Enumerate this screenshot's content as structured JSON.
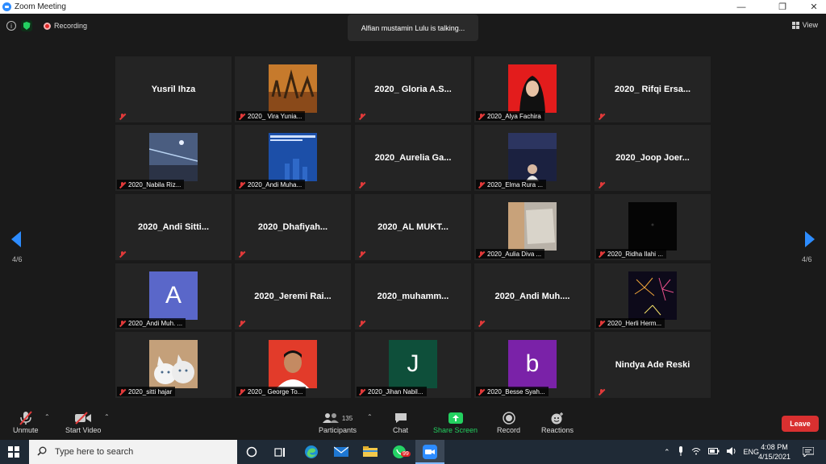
{
  "window": {
    "title": "Zoom Meeting",
    "minimize": "—",
    "restore": "❐",
    "close": "✕"
  },
  "topbar": {
    "recording_label": "Recording",
    "talking_text": "Alfian mustamin Lulu is talking...",
    "view_label": "View",
    "info_glyph": "i"
  },
  "navigation": {
    "page_left": "4/6",
    "page_right": "4/6"
  },
  "tiles": [
    {
      "center": "Yusril Ihza",
      "label": ""
    },
    {
      "center": "",
      "label": "2020_ Vira Yunia...",
      "video": "sunset-trees"
    },
    {
      "center": "2020_ Gloria A.S...",
      "label": ""
    },
    {
      "center": "",
      "label": "2020_Alya Fachira",
      "video": "hijab-red"
    },
    {
      "center": "2020_ Rifqi Ersa...",
      "label": ""
    },
    {
      "center": "",
      "label": "2020_Nabila Riz...",
      "video": "anime-night"
    },
    {
      "center": "",
      "label": "2020_Andi Muha...",
      "video": "blue-slide"
    },
    {
      "center": "2020_Aurelia Ga...",
      "label": ""
    },
    {
      "center": "",
      "label": "2020_Elma Rura ...",
      "video": "dark-room"
    },
    {
      "center": "2020_Joop Joer...",
      "label": ""
    },
    {
      "center": "2020_Andi Sitti...",
      "label": ""
    },
    {
      "center": "2020_Dhafiyah...",
      "label": ""
    },
    {
      "center": "2020_AL MUKT...",
      "label": ""
    },
    {
      "center": "",
      "label": "2020_Aulia Diva ...",
      "video": "wall-photo"
    },
    {
      "center": "",
      "label": "2020_Ridha Ilahi ...",
      "video": "black"
    },
    {
      "center": "",
      "label": "2020_Andi Muh. ...",
      "avatar": "A",
      "avatar_color": "#5a67c9"
    },
    {
      "center": "2020_Jeremi Rai...",
      "label": ""
    },
    {
      "center": "2020_muhamm...",
      "label": ""
    },
    {
      "center": "2020_Andi Muh....",
      "label": ""
    },
    {
      "center": "",
      "label": "2020_Herli Herm...",
      "video": "fireworks"
    },
    {
      "center": "",
      "label": "2020_sitti hajar",
      "video": "cats"
    },
    {
      "center": "",
      "label": "2020_ George To...",
      "video": "portrait-red"
    },
    {
      "center": "",
      "label": "2020_Jihan Nabil...",
      "avatar": "J",
      "avatar_color": "#0e4f3a"
    },
    {
      "center": "",
      "label": "2020_Besse Syah...",
      "avatar": "b",
      "avatar_color": "#7a22a8"
    },
    {
      "center": "Nindya Ade Reski",
      "label": ""
    }
  ],
  "toolbar": {
    "unmute": "Unmute",
    "start_video": "Start Video",
    "participants": "Participants",
    "participants_count": "135",
    "chat": "Chat",
    "share_screen": "Share Screen",
    "record": "Record",
    "reactions": "Reactions",
    "leave": "Leave"
  },
  "taskbar": {
    "search_placeholder": "Type here to search",
    "whatsapp_badge": "99",
    "language": "ENG",
    "time": "4:08 PM",
    "date": "4/15/2021"
  },
  "colors": {
    "accent": "#2d8cff",
    "leave": "#d93030",
    "share": "#23d160"
  }
}
